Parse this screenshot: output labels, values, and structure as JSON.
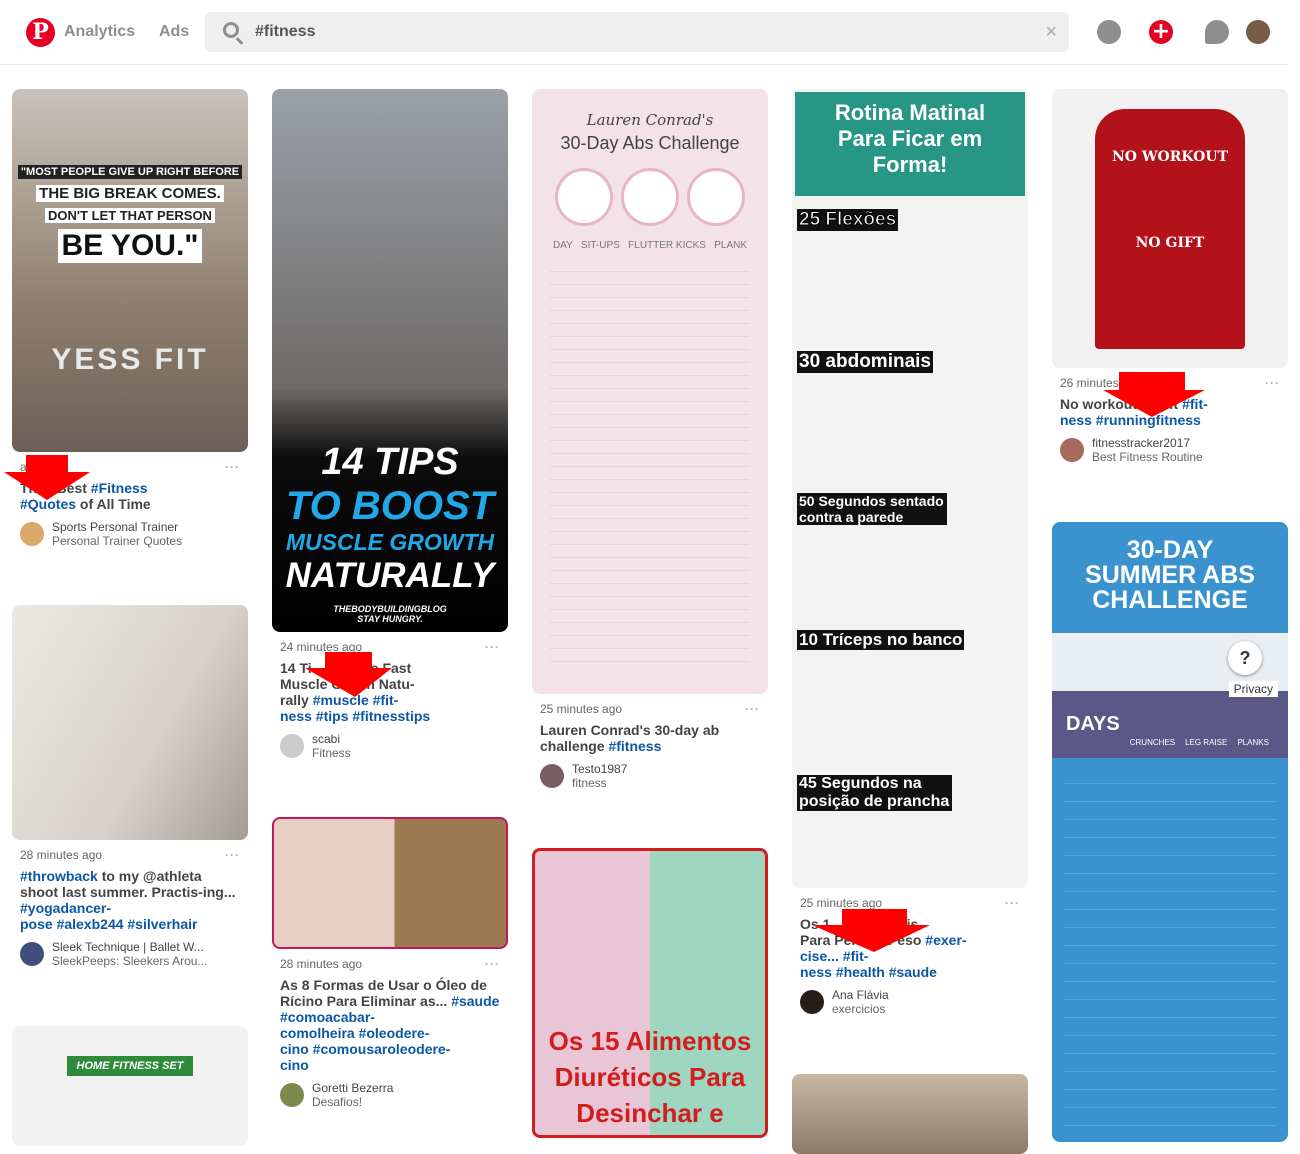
{
  "header": {
    "nav": [
      "Analytics",
      "Ads"
    ],
    "search_value": "#fitness",
    "clear": "×",
    "icons": [
      "pinterest-logo",
      "compass-icon",
      "add-icon",
      "chat-icon",
      "avatar"
    ]
  },
  "colors": {
    "brand": "#e60023",
    "hashtag": "#0b57a4",
    "arrow": "#ff0000"
  },
  "columns": [
    [
      {
        "img_text": [
          "\"MOST PEOPLE GIVE UP RIGHT BEFORE",
          "THE BIG BREAK COMES.",
          "DON'T LET THAT PERSON",
          "BE YOU.\"",
          "YESS FIT"
        ],
        "time": "ago",
        "title": [
          {
            "t": "Th     Best "
          },
          {
            "t": "#Fitness",
            "tag": true
          },
          {
            "t": "\n"
          },
          {
            "t": "#Quotes",
            "tag": true
          },
          {
            "t": " of All Time"
          }
        ],
        "author": "Sports Personal Trainer",
        "board": "Personal Trainer Quotes"
      },
      {
        "img_text": [],
        "time": "28 minutes ago",
        "title": [
          {
            "t": "#throwback",
            "tag": true
          },
          {
            "t": " to my @athleta shoot last summer. Practis-ing... "
          },
          {
            "t": "#yogadancer-\npose #alexb244 #silverhair",
            "tag": true
          }
        ],
        "author": "Sleek Technique | Ballet W...",
        "board": "SleekPeeps: Sleekers Arou..."
      },
      {
        "img_text": [
          "HOME FITNESS SET"
        ]
      }
    ],
    [
      {
        "img_text": [
          "14 TIPS",
          "TO BOOST",
          "MUSCLE GROWTH",
          "NATURALLY",
          "THEBODYBUILDINGBLOG STAY HUNGRY."
        ],
        "time": "24 minutes ago",
        "title": [
          {
            "t": "14 Ti            ate Fast\nMuscle G     th Natu-\nrally "
          },
          {
            "t": "#muscle #fit-\nness #tips #fitnesstips",
            "tag": true
          }
        ],
        "author": "scabi",
        "board": "Fitness"
      },
      {
        "img_text": [],
        "time": "28 minutes ago",
        "title": [
          {
            "t": "As 8 Formas de Usar o Óleo de Rícino Para Eliminar as... "
          },
          {
            "t": "#saude #comoacabar-\ncomolheira #oleodere-\ncino #comousaroleodere-\ncino",
            "tag": true
          }
        ],
        "author": "Goretti Bezerra",
        "board": "Desafios!"
      }
    ],
    [
      {
        "img_text": [
          "Lauren Conrad's",
          "30-Day Abs Challenge",
          "DAY   SIT-UPS   FLUTTER KICKS   PLANK"
        ],
        "time": "25 minutes ago",
        "title": [
          {
            "t": "Lauren Conrad's 30-day ab challenge "
          },
          {
            "t": "#fitness",
            "tag": true
          }
        ],
        "author": "Testo1987",
        "board": "fitness"
      },
      {
        "img_text": [
          "Os 15 Alimentos",
          "Diuréticos Para",
          "Desinchar e"
        ]
      }
    ],
    [
      {
        "img_text": [
          "Rotina Matinal Para Ficar em Forma!",
          "25 Flexões",
          "30 abdominais",
          "50 Segundos sentado contra a parede",
          "10 Tríceps no banco",
          "45 Segundos na posição de prancha"
        ],
        "time": "25 minutes ago",
        "title": [
          {
            "t": "Os 1        incríveis\nPara Per     e Peso "
          },
          {
            "t": "#exer-\ncise... #fit-\nness #health #saude",
            "tag": true
          }
        ],
        "author": "Ana Flávia",
        "board": "exercicios"
      },
      {
        "img_text": []
      }
    ],
    [
      {
        "img_text": [
          "NO WORKOUT",
          "NO GIFT"
        ],
        "time": "26 minutes",
        "title": [
          {
            "t": "No workout     gift "
          },
          {
            "t": "#fit-\nness #runningfitness",
            "tag": true
          }
        ],
        "author": "fitnesstracker2017",
        "board": "Best Fitness Routine"
      },
      {
        "img_text": [
          "30-DAY SUMMER ABS CHALLENGE",
          "DAYS",
          "CRUNCHES",
          "LEG RAISE",
          "PLANKS"
        ],
        "help": "?",
        "privacy": "Privacy"
      }
    ]
  ]
}
